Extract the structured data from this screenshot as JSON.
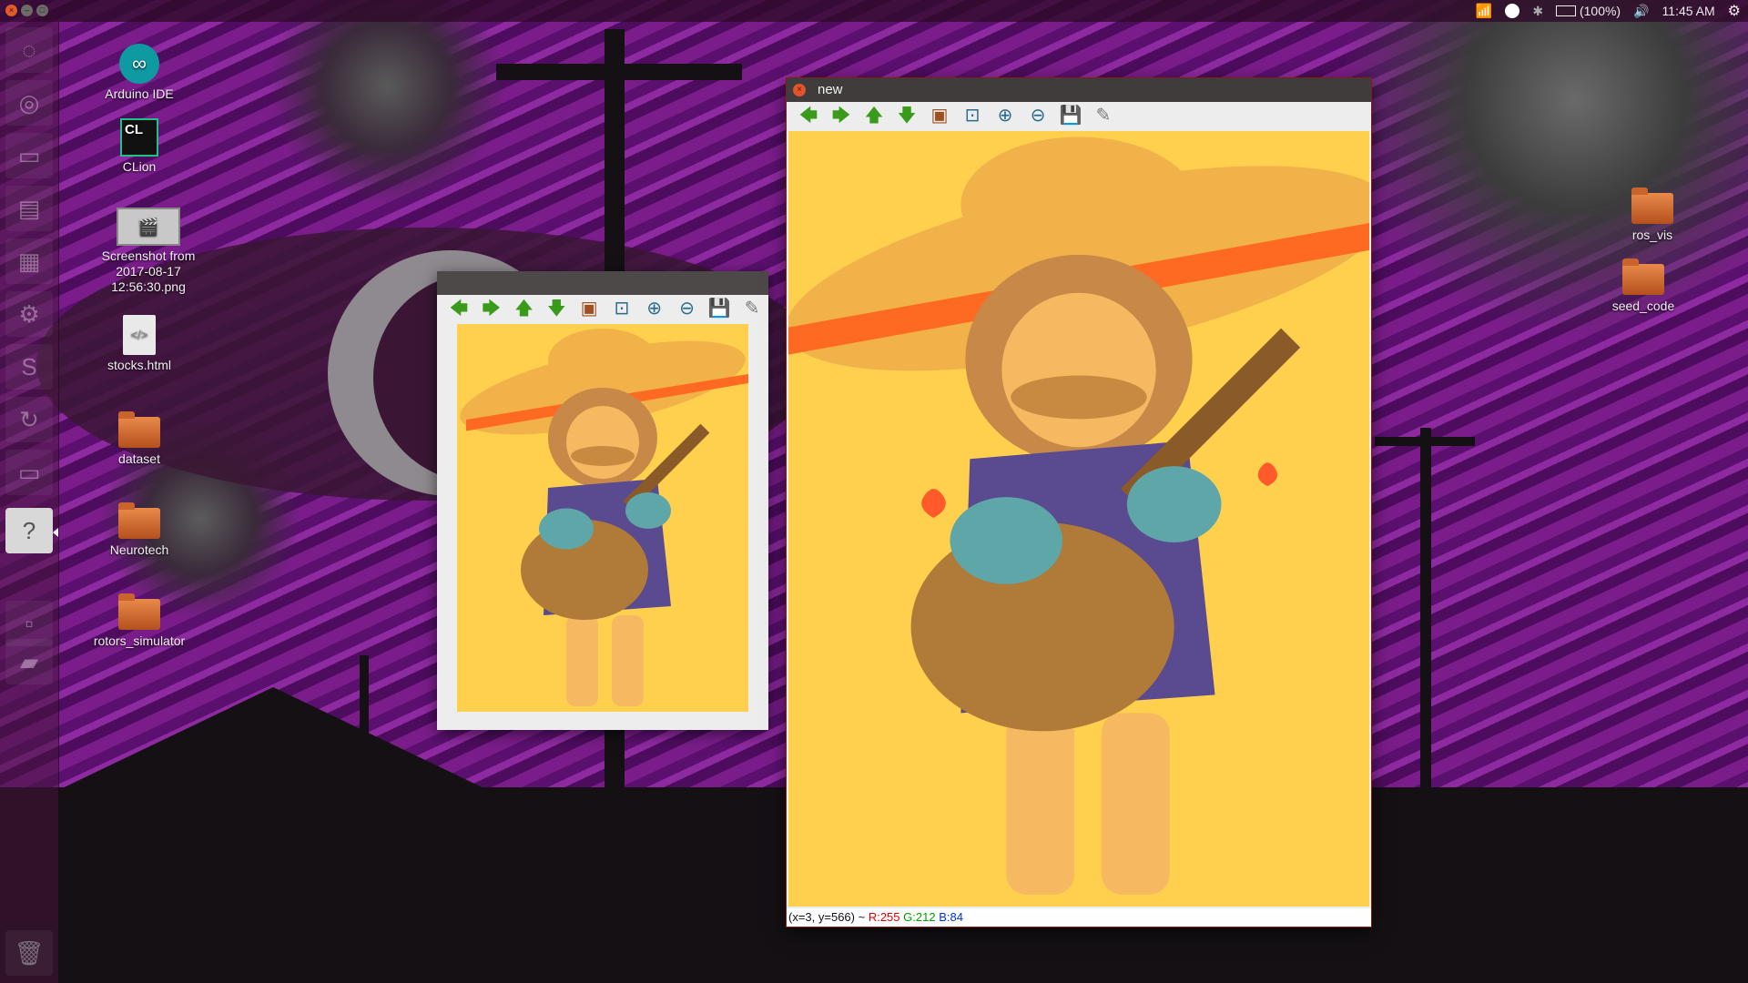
{
  "panel": {
    "battery": "(100%)",
    "time": "11:45 AM",
    "icons": [
      "wifi-icon",
      "notification-dot-icon",
      "bluetooth-icon",
      "battery-icon",
      "volume-icon",
      "gear-icon"
    ]
  },
  "launcher": {
    "items": [
      "dash-icon",
      "chrome-icon",
      "terminal-icon",
      "files-icon",
      "text-editor-icon",
      "settings-icon",
      "sublime-icon",
      "update-icon",
      "window-icon",
      "help-icon",
      "small-icon",
      "drive-icon",
      "trash-icon"
    ],
    "help_glyph": "?"
  },
  "desktop": {
    "icons": [
      {
        "label": "Arduino IDE",
        "kind": "arduino-icon"
      },
      {
        "label": "CLion",
        "kind": "clion-icon",
        "glyph": "CL"
      },
      {
        "label": "Screenshot from 2017-08-17 12:56:30.png",
        "kind": "image-file-icon"
      },
      {
        "label": "stocks.html",
        "kind": "html-file-icon",
        "glyph": "</>"
      },
      {
        "label": "dataset",
        "kind": "folder-icon"
      },
      {
        "label": "Neurotech",
        "kind": "folder-icon"
      },
      {
        "label": "rotors_simulator",
        "kind": "folder-icon"
      },
      {
        "label": "ros_vis",
        "kind": "folder-icon"
      },
      {
        "label": "seed_code",
        "kind": "folder-icon"
      }
    ]
  },
  "toolbar_buttons": [
    {
      "name": "arrow-left-icon",
      "glyph": "🡄"
    },
    {
      "name": "arrow-right-icon",
      "glyph": "🡆"
    },
    {
      "name": "arrow-up-icon",
      "glyph": "🡅"
    },
    {
      "name": "arrow-down-icon",
      "glyph": "🡇"
    },
    {
      "name": "fit-image-icon",
      "glyph": "▣"
    },
    {
      "name": "zoom-fit-icon",
      "glyph": "⊡"
    },
    {
      "name": "zoom-in-icon",
      "glyph": "⊕"
    },
    {
      "name": "zoom-out-icon",
      "glyph": "⊖"
    },
    {
      "name": "save-icon",
      "glyph": "💾"
    },
    {
      "name": "properties-icon",
      "glyph": "✎"
    }
  ],
  "big_window": {
    "title": "new",
    "status": {
      "coords": "(x=3, y=566) ~ ",
      "r": "R:255",
      "g": "G:212",
      "b": "B:84"
    }
  },
  "colors": {
    "image_background": "#ffd04e",
    "sombrero": "#f2b24a",
    "sombrero_trim": "#ff6a22",
    "poncho": "#5a4a90",
    "guitar": "#b07a38",
    "sleeves": "#5fa6a8"
  }
}
